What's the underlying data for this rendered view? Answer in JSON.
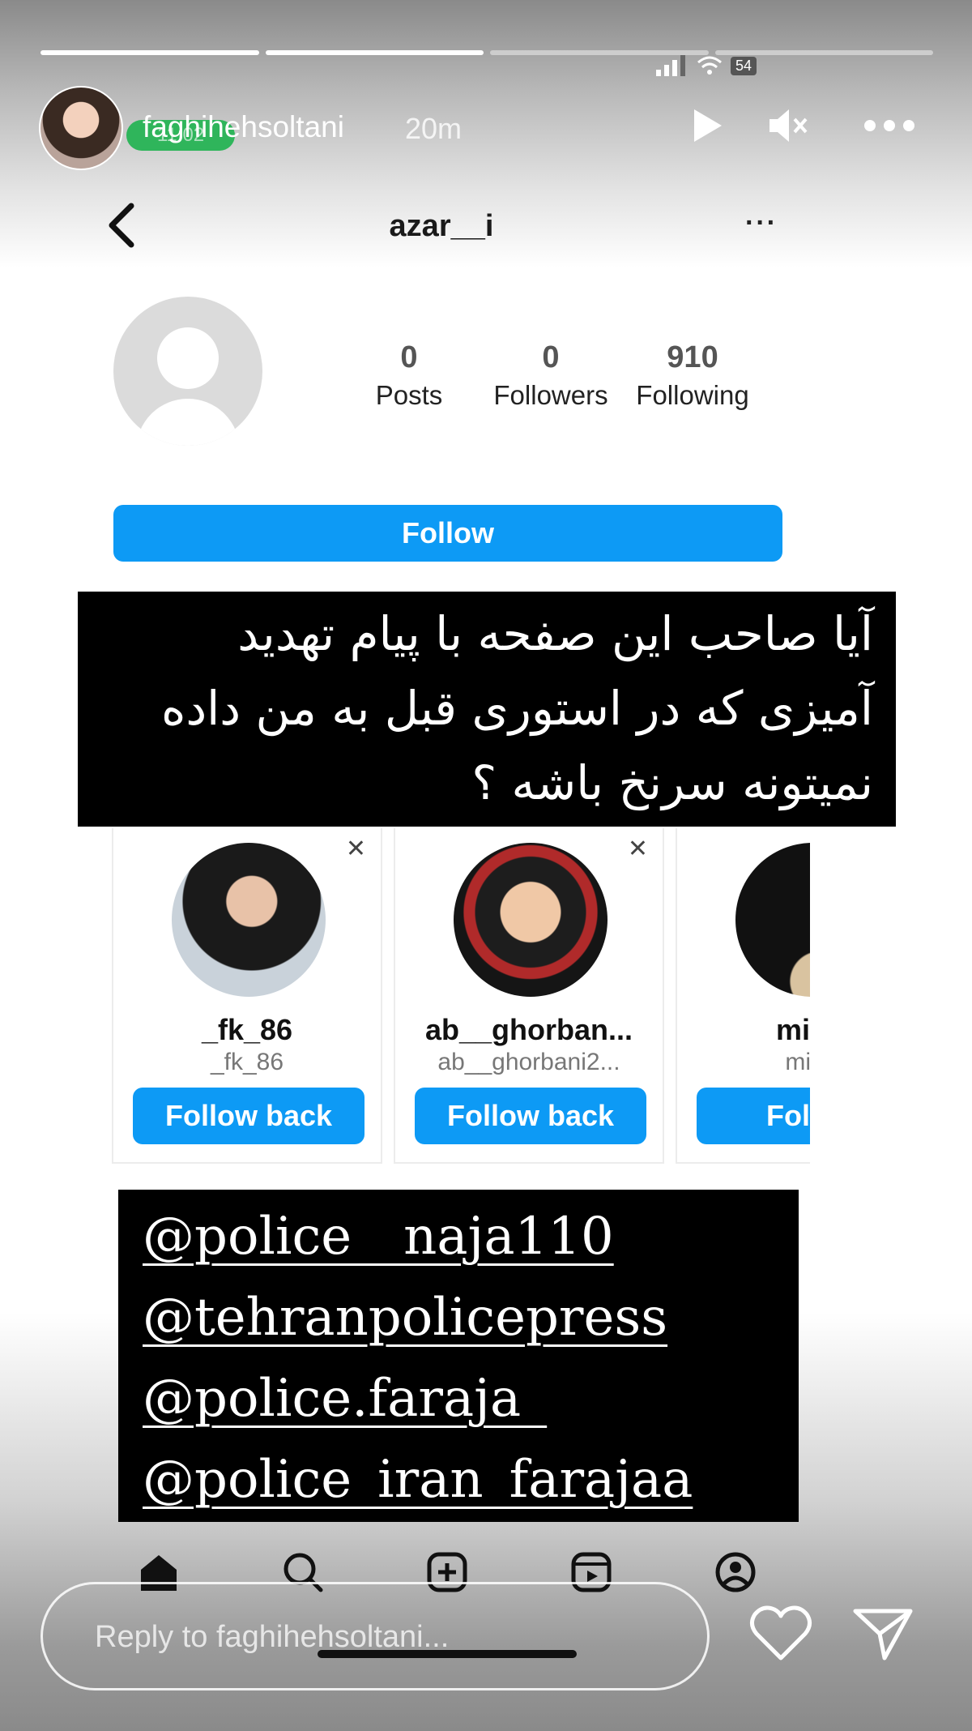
{
  "story": {
    "username": "faghihehsoltani",
    "time_ago": "20m",
    "progress": {
      "total_segments": 4,
      "completed_segments": 2
    },
    "status_ghost": "11:02",
    "battery": "54"
  },
  "profile": {
    "name": "azar__i",
    "stats": [
      {
        "value": "0",
        "label": "Posts"
      },
      {
        "value": "0",
        "label": "Followers"
      },
      {
        "value": "910",
        "label": "Following"
      }
    ],
    "follow_label": "Follow"
  },
  "question_lines": [
    "آیا صاحب این صفحه با پیام تهدید",
    "آمیزی که در استوری قبل به من داده",
    "نمیتونه سرنخ باشه ؟"
  ],
  "suggestions": [
    {
      "name": "_fk_86",
      "handle": "_fk_86",
      "button": "Follow back"
    },
    {
      "name": "ab__ghorban...",
      "handle": "ab__ghorbani2...",
      "button": "Follow back"
    },
    {
      "name": "mino",
      "handle": "minc",
      "button": "Follow"
    }
  ],
  "police_tags": [
    "@police__naja110",
    "@tehranpolicepress",
    "@police.faraja_",
    "@police_iran_farajaa"
  ],
  "reply": {
    "placeholder": "Reply to faghihehsoltani..."
  },
  "icons": [
    "play-icon",
    "mute-icon",
    "more-icon",
    "back-icon",
    "home-icon",
    "search-icon",
    "create-icon",
    "reels-icon",
    "profile-icon",
    "heart-icon",
    "send-icon"
  ],
  "colors": {
    "follow_blue": "#0d9af5",
    "text_overlay_bg": "#000000"
  }
}
